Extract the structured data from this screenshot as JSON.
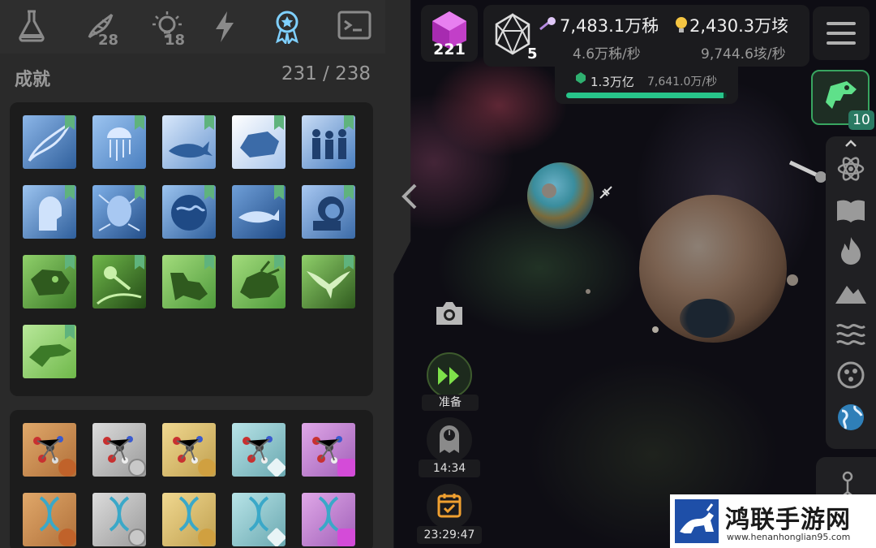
{
  "tabs": [
    {
      "name": "flask",
      "count": ""
    },
    {
      "name": "dna",
      "count": "28"
    },
    {
      "name": "lightbulb",
      "count": "18"
    },
    {
      "name": "lightning",
      "count": ""
    },
    {
      "name": "award",
      "count": ""
    },
    {
      "name": "terminal",
      "count": ""
    }
  ],
  "achievements": {
    "title": "成就",
    "count": "231 / 238"
  },
  "resources": {
    "cube_count": "221",
    "d20_count": "5",
    "res1_value": "7,483.1万秭",
    "res1_rate": "4.6万秭/秒",
    "res2_value": "2,430.3万垓",
    "res2_rate": "9,744.6垓/秒",
    "sub_value": "1.3万亿",
    "sub_rate": "7,641.0万/秒",
    "sub_progress": 0.98
  },
  "dino": {
    "count": "10"
  },
  "controls": {
    "ready_label": "准备",
    "timer_label": "14:34",
    "calendar_label": "23:29:47"
  },
  "watermark": {
    "title": "鸿联手游网",
    "url": "www.henanhonglian95.com"
  },
  "colors": {
    "blue_tile": "#4a7fc0",
    "green_tile": "#4f9a3c",
    "accent_green": "#27c48a",
    "cube_magenta": "#d44bd8"
  }
}
